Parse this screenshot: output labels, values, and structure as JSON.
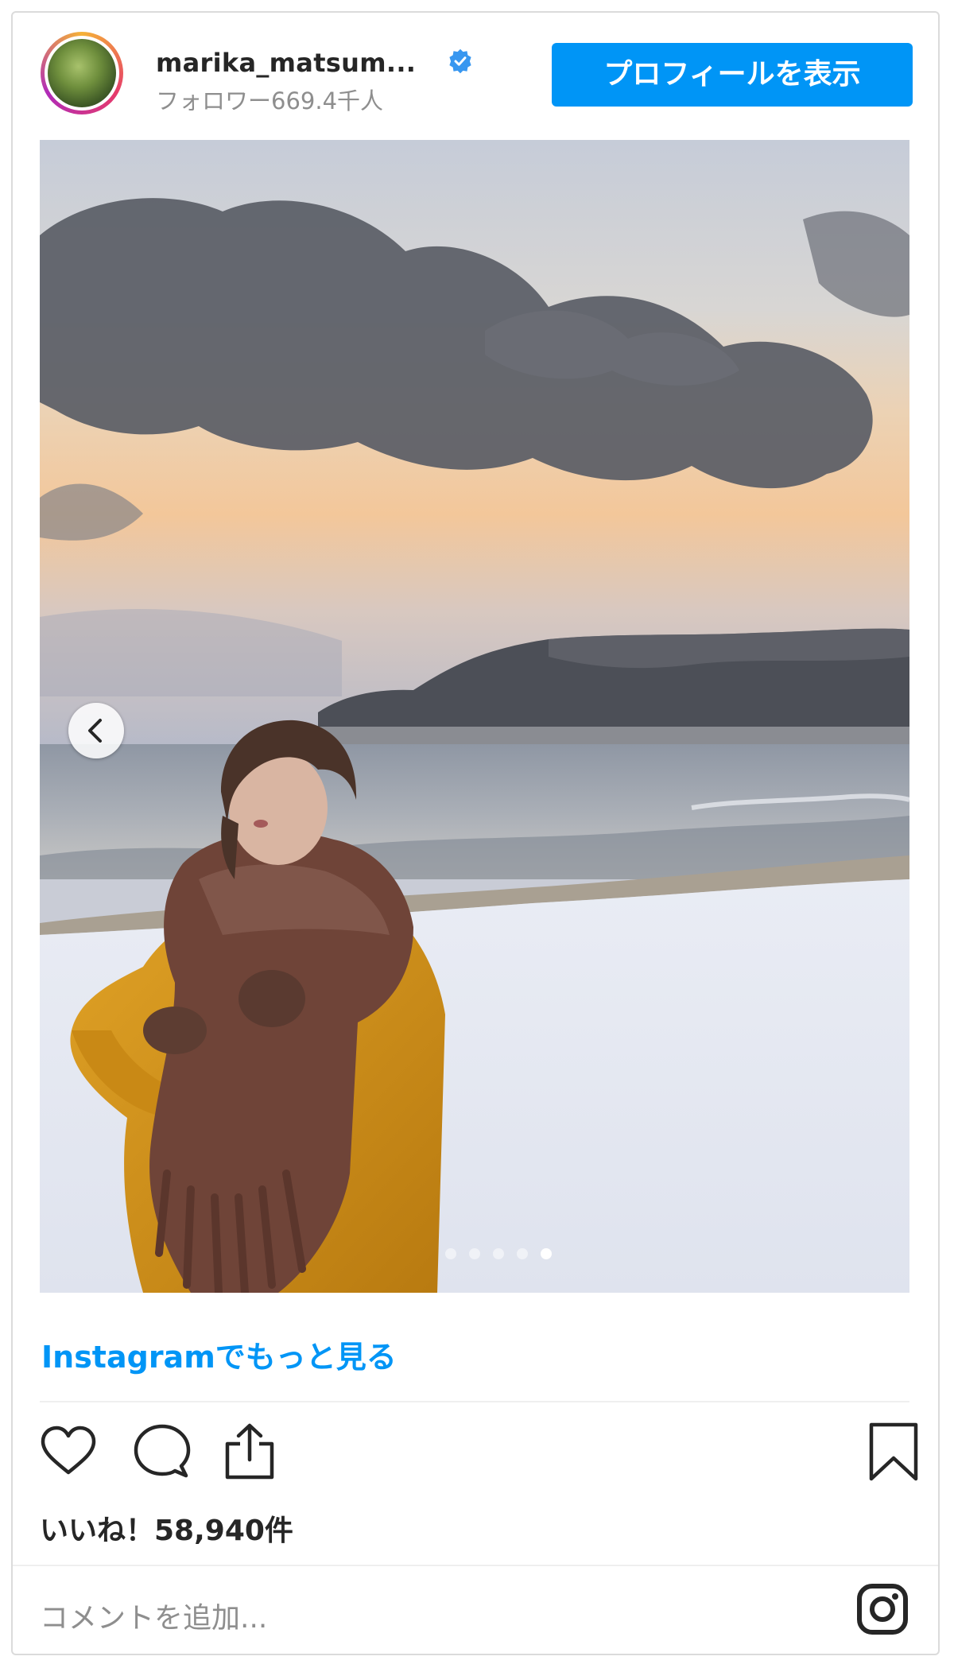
{
  "header": {
    "username": "marika_matsum...",
    "followers": "フォロワー669.4千人",
    "profile_button": "プロフィールを表示"
  },
  "carousel": {
    "dot_count": 5,
    "active_index": 4
  },
  "more_link": "Instagramでもっと見る",
  "likes": "いいね！58,940件",
  "comment_placeholder": "コメントを追加...",
  "colors": {
    "accent": "#0095f6",
    "text": "#262626",
    "muted": "#8e8e8e",
    "border": "#dbdbdb"
  },
  "icons": {
    "verified": "verified-badge-icon",
    "prev": "chevron-left-icon",
    "like": "heart-icon",
    "comment": "comment-bubble-icon",
    "share": "share-upload-icon",
    "save": "bookmark-icon",
    "logo": "instagram-logo-icon"
  }
}
